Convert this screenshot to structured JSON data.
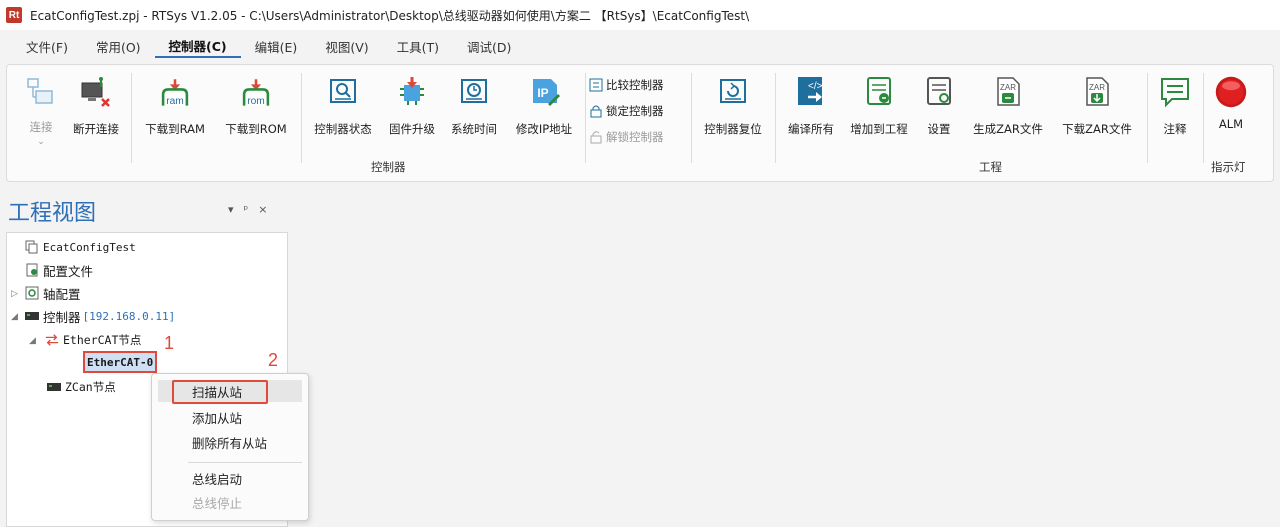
{
  "window": {
    "app_icon_text": "Rt",
    "title": "EcatConfigTest.zpj - RTSys V1.2.05 - C:\\Users\\Administrator\\Desktop\\总线驱动器如何使用\\方案二 【RtSys】\\EcatConfigTest\\"
  },
  "menu": [
    "文件(F)",
    "常用(O)",
    "控制器(C)",
    "编辑(E)",
    "视图(V)",
    "工具(T)",
    "调试(D)"
  ],
  "ribbon": {
    "connect": "连接",
    "disconnect": "断开连接",
    "download_ram": "下载到RAM",
    "download_rom": "下载到ROM",
    "ram_text": "ram",
    "rom_text": "rom",
    "controller_status": "控制器状态",
    "firmware_upgrade": "固件升级",
    "system_time": "系统时间",
    "modify_ip": "修改IP地址",
    "compare_controller": "比较控制器",
    "lock_controller": "锁定控制器",
    "unlock_controller": "解锁控制器",
    "controller_reset": "控制器复位",
    "compile_all": "编译所有",
    "add_to_project": "增加到工程",
    "settings": "设置",
    "generate_zar": "生成ZAR文件",
    "download_zar": "下载ZAR文件",
    "zar_text": "ZAR",
    "comment": "注释",
    "alm": "ALM",
    "group_controller": "控制器",
    "group_project": "工程",
    "group_indicator": "指示灯"
  },
  "pane": {
    "title": "工程视图",
    "controls": [
      "▾",
      "ᵖ",
      "×"
    ]
  },
  "tree": {
    "root": "EcatConfigTest",
    "config_file": "配置文件",
    "axis_config": "轴配置",
    "controller": "控制器",
    "controller_ip": "[192.168.0.11]",
    "ethercat_node": "EtherCAT节点",
    "ethercat_0": "EtherCAT-0",
    "zcan_node": "ZCan节点"
  },
  "annotations": {
    "one": "1",
    "two": "2"
  },
  "context_menu": {
    "scan_slaves": "扫描从站",
    "add_slave": "添加从站",
    "delete_all_slaves": "删除所有从站",
    "bus_start": "总线启动",
    "bus_stop": "总线停止"
  }
}
